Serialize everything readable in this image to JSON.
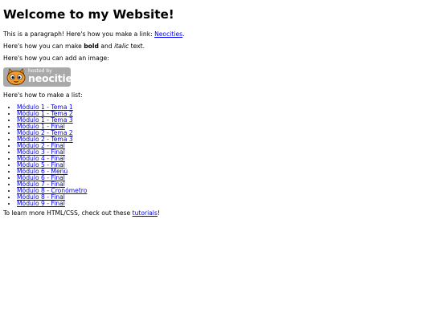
{
  "page": {
    "title": "Welcome to my Website!",
    "intro": {
      "text": "This is a paragraph! Here's how you make a link: ",
      "link": "Neocities",
      "end": "."
    },
    "formatting": {
      "before": "Here's how you can make ",
      "bold": "bold",
      "middle": " and ",
      "italic": "italic",
      "after": " text."
    },
    "image_intro": "Here's how you can add an image:",
    "badge": {
      "small": "hosted by",
      "big": "neocities"
    },
    "list_intro": "Here's how to make a list:",
    "list_items": [
      "Módulo 1 - Tema 1",
      "Módulo 1 - Tema 2",
      "Módulo 1 - Tema 3",
      "Módulo 1 - Final",
      "Módulo 2 - Tema 2",
      "Módulo 2 - Tema 3",
      "Módulo 2 - Final",
      "Módulo 3 - Final",
      "Módulo 4 - Final",
      "Módulo 5 - Final",
      "Módulo 6 - Menú",
      "Módulo 6 - Final",
      "Módulo 7 - Final",
      "Módulo 8 - Cronómetro",
      "Módulo 8 - Final",
      "Módulo 9 - Final"
    ],
    "outro": {
      "text": "To learn more HTML/CSS, check out these ",
      "link": "tutorials",
      "end": "!"
    }
  },
  "colors": {
    "link": "#0000ee",
    "badge_bg": "#a9a9a9",
    "cat_orange": "#f39c2b"
  }
}
